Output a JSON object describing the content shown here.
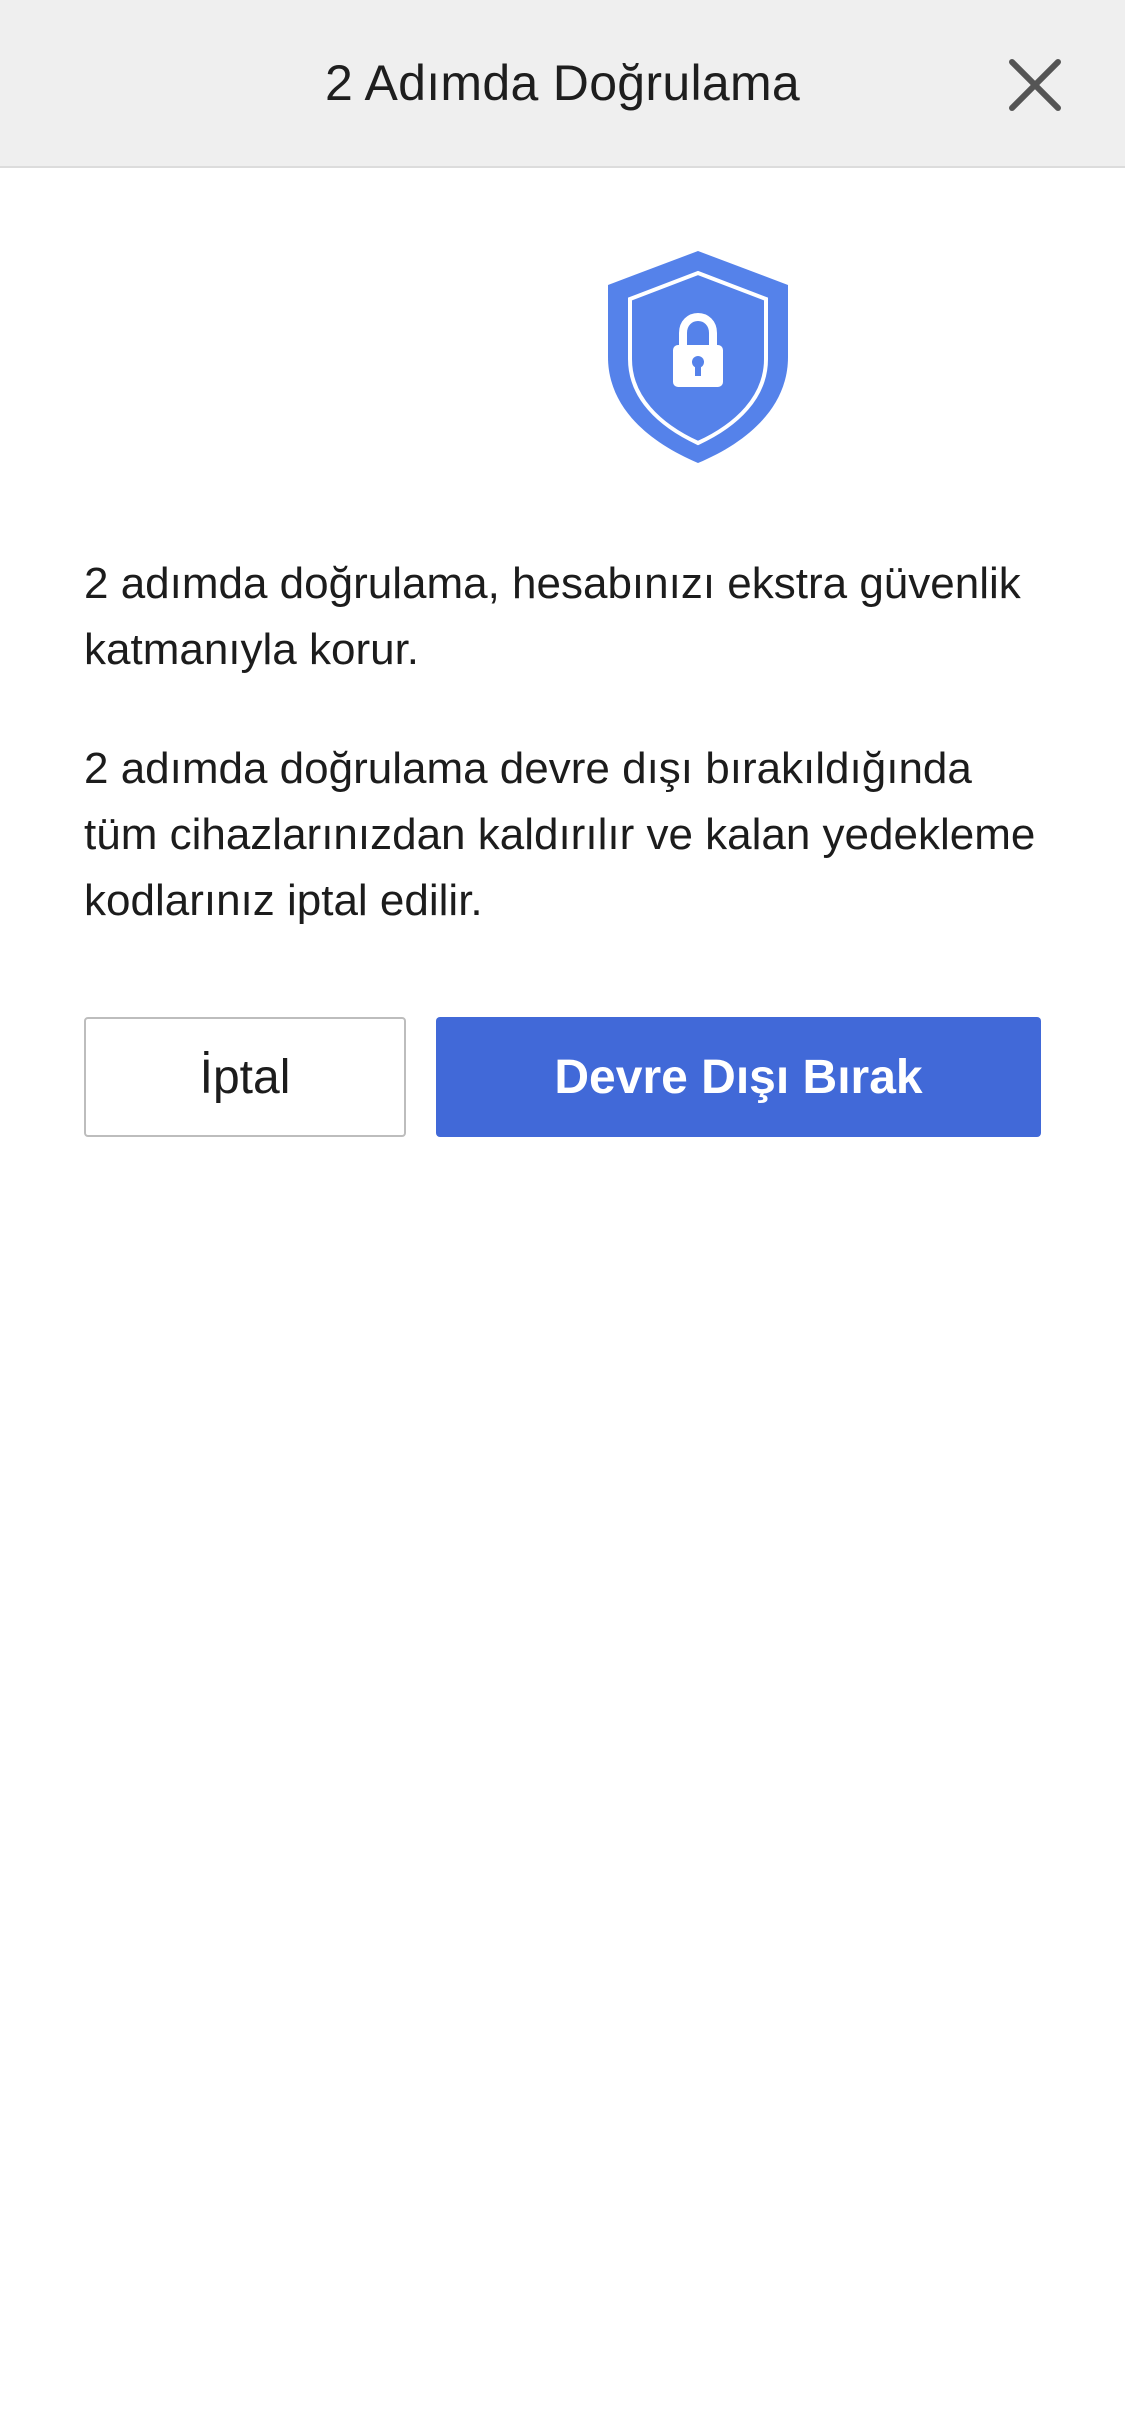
{
  "header": {
    "title": "2 Adımda Doğrulama"
  },
  "icons": {
    "close": "close-icon",
    "shield": "shield-lock-icon"
  },
  "content": {
    "paragraph_1": "2 adımda doğrulama, hesabınızı ekstra güvenlik katmanıyla korur.",
    "paragraph_2": "2 adımda doğrulama devre dışı bırakıldığında tüm cihazlarınızdan kaldırılır ve kalan yedekleme kodlarınız iptal edilir."
  },
  "actions": {
    "cancel_label": "İptal",
    "disable_label": "Devre Dışı Bırak"
  },
  "colors": {
    "header_bg": "#efefef",
    "shield_blue": "#5582ea",
    "primary_button": "#4169d8",
    "text": "#1c1c1c"
  }
}
